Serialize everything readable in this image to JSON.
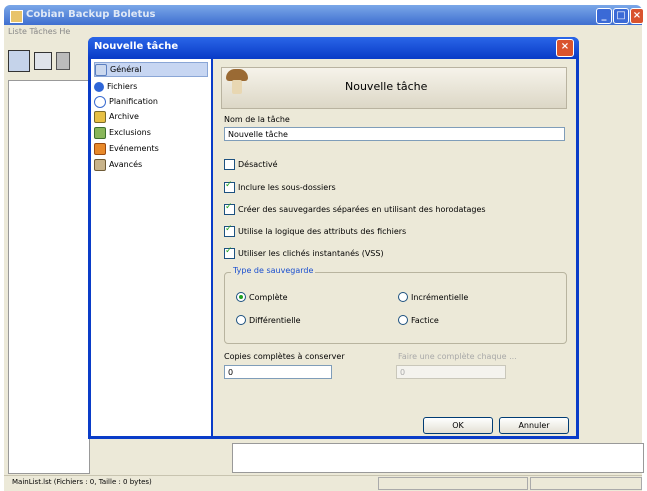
{
  "app": {
    "title": "Cobian Backup Boletus",
    "menu": "Liste  Tâches  He",
    "status_text": "MainList.lst (Fichiers : 0, Taille : 0 bytes)"
  },
  "dialog": {
    "title": "Nouvelle tâche",
    "banner_title": "Nouvelle tâche",
    "nav": [
      {
        "label": "Général",
        "icon": "general-icon",
        "selected": true
      },
      {
        "label": "Fichiers",
        "icon": "files-icon",
        "selected": false
      },
      {
        "label": "Planification",
        "icon": "schedule-icon",
        "selected": false
      },
      {
        "label": "Archive",
        "icon": "archive-icon",
        "selected": false
      },
      {
        "label": "Exclusions",
        "icon": "exclusions-icon",
        "selected": false
      },
      {
        "label": "Evénements",
        "icon": "events-icon",
        "selected": false
      },
      {
        "label": "Avancés",
        "icon": "advanced-icon",
        "selected": false
      }
    ],
    "task_name_label": "Nom de la tâche",
    "task_name_value": "Nouvelle tâche",
    "checkboxes": [
      {
        "label": "Désactivé",
        "checked": false
      },
      {
        "label": "Inclure les sous-dossiers",
        "checked": true
      },
      {
        "label": "Créer des sauvegardes séparées en utilisant des horodatages",
        "checked": true
      },
      {
        "label": "Utilise la logique des attributs des fichiers",
        "checked": true
      },
      {
        "label": "Utiliser les clichés instantanés (VSS)",
        "checked": true
      }
    ],
    "backup_type": {
      "legend": "Type de sauvegarde",
      "options": [
        {
          "label": "Complète",
          "selected": true
        },
        {
          "label": "Incrémentielle",
          "selected": false
        },
        {
          "label": "Différentielle",
          "selected": false
        },
        {
          "label": "Factice",
          "selected": false
        }
      ]
    },
    "full_copies_label": "Copies complètes à conserver",
    "full_copies_value": "0",
    "full_every_label": "Faire une complète chaque ...",
    "full_every_value": "0",
    "ok_label": "OK",
    "cancel_label": "Annuler"
  },
  "colors": {
    "dialog_frame": "#0a3cc8",
    "check_green": "#21a121",
    "legend_blue": "#1a4fcf"
  }
}
